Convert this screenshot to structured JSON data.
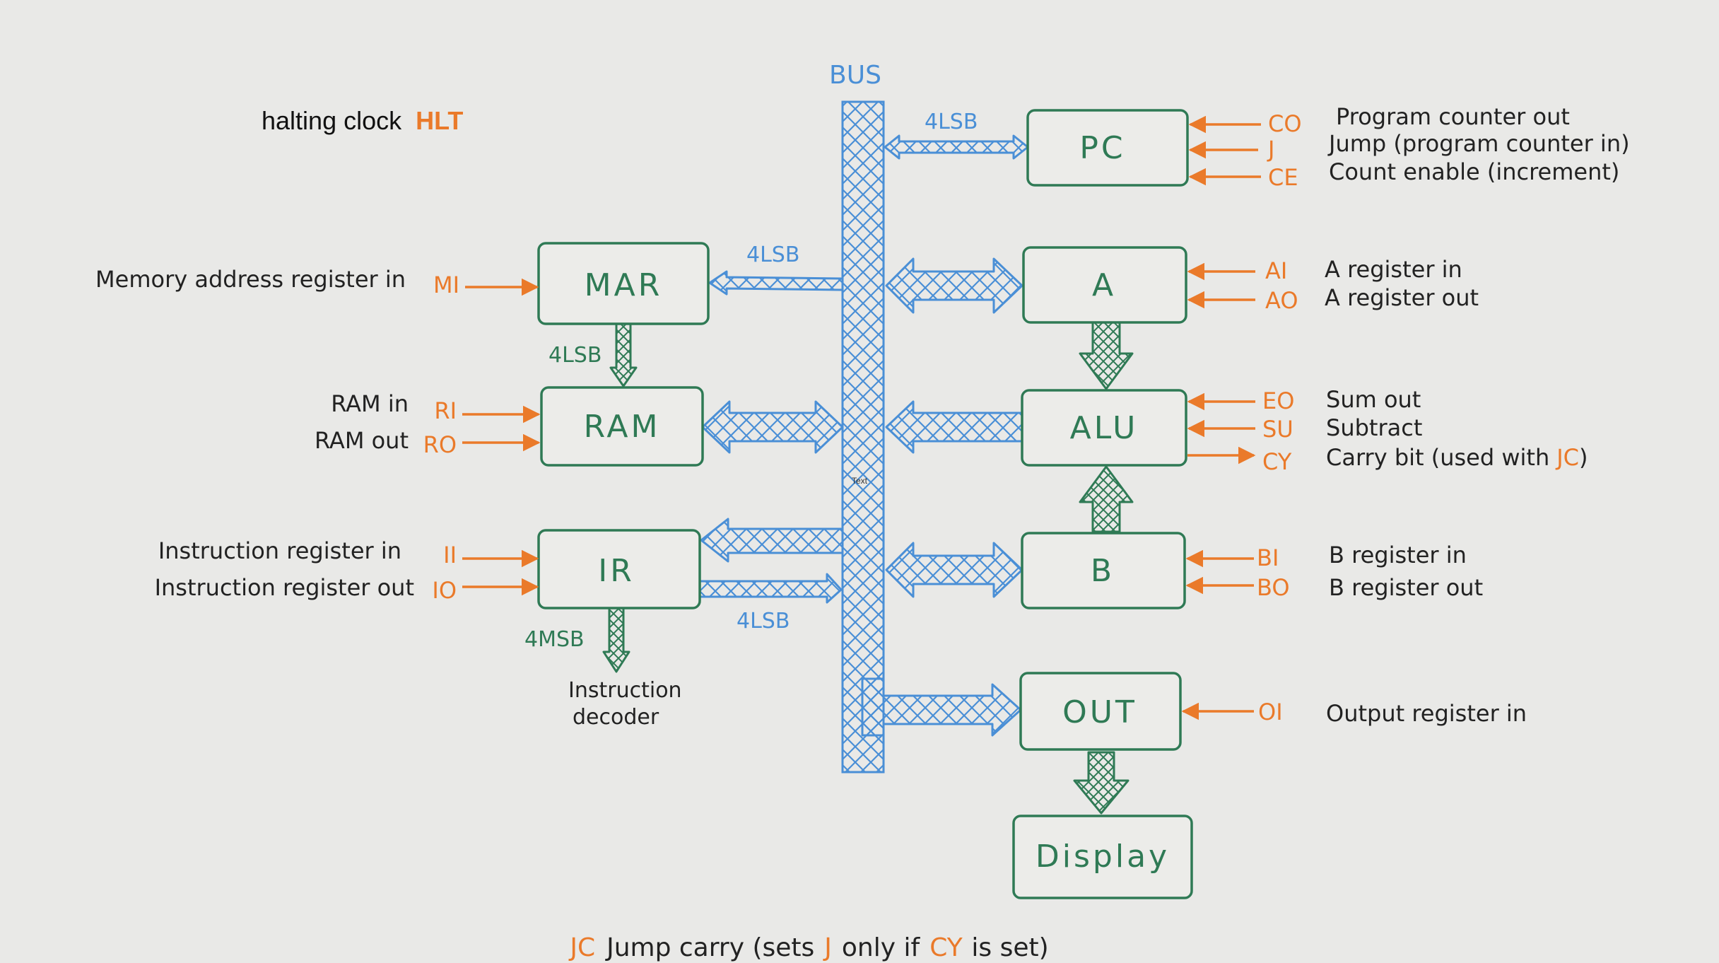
{
  "colors": {
    "background": "#e9e9e7",
    "box": "#2f7a55",
    "bus": "#4a8fd6",
    "signal": "#ea7a2a",
    "text": "#222222"
  },
  "hlt": {
    "label": "halting clock",
    "code": "HLT"
  },
  "bus_label": "BUS",
  "overlay_text": "Text",
  "modules": {
    "pc": "PC",
    "mar": "MAR",
    "ram": "RAM",
    "ir": "IR",
    "a": "A",
    "alu": "ALU",
    "b": "B",
    "out": "OUT",
    "display": "Display"
  },
  "bus_widths": {
    "pc": "4LSB",
    "mar": "4LSB",
    "mar_ram": "4LSB",
    "ir_out": "4LSB",
    "ir_decoder": "4MSB"
  },
  "decoder_label": [
    "Instruction",
    "decoder"
  ],
  "signals": {
    "co": {
      "code": "CO",
      "desc": "Program counter out"
    },
    "j": {
      "code": "J",
      "desc": "Jump (program counter in)"
    },
    "ce": {
      "code": "CE",
      "desc": "Count enable (increment)"
    },
    "ai": {
      "code": "AI",
      "desc": "A register in"
    },
    "ao": {
      "code": "AO",
      "desc": "A register out"
    },
    "eo": {
      "code": "EO",
      "desc": "Sum out"
    },
    "su": {
      "code": "SU",
      "desc": "Subtract"
    },
    "cy": {
      "code": "CY",
      "desc": "Carry bit (used with",
      "ref": "JC",
      "tail": ")"
    },
    "bi": {
      "code": "BI",
      "desc": "B register in"
    },
    "bo": {
      "code": "BO",
      "desc": "B register out"
    },
    "oi": {
      "code": "OI",
      "desc": "Output register in"
    },
    "mi": {
      "code": "MI",
      "desc": "Memory address register in"
    },
    "ri": {
      "code": "RI",
      "desc": "RAM in"
    },
    "ro": {
      "code": "RO",
      "desc": "RAM out"
    },
    "ii": {
      "code": "II",
      "desc": "Instruction register in"
    },
    "io": {
      "code": "IO",
      "desc": "Instruction register out"
    }
  },
  "footer": {
    "jc": "JC",
    "t1": "Jump carry (sets",
    "j": "J",
    "t2": "only if",
    "cy": "CY",
    "t3": "is set)"
  }
}
